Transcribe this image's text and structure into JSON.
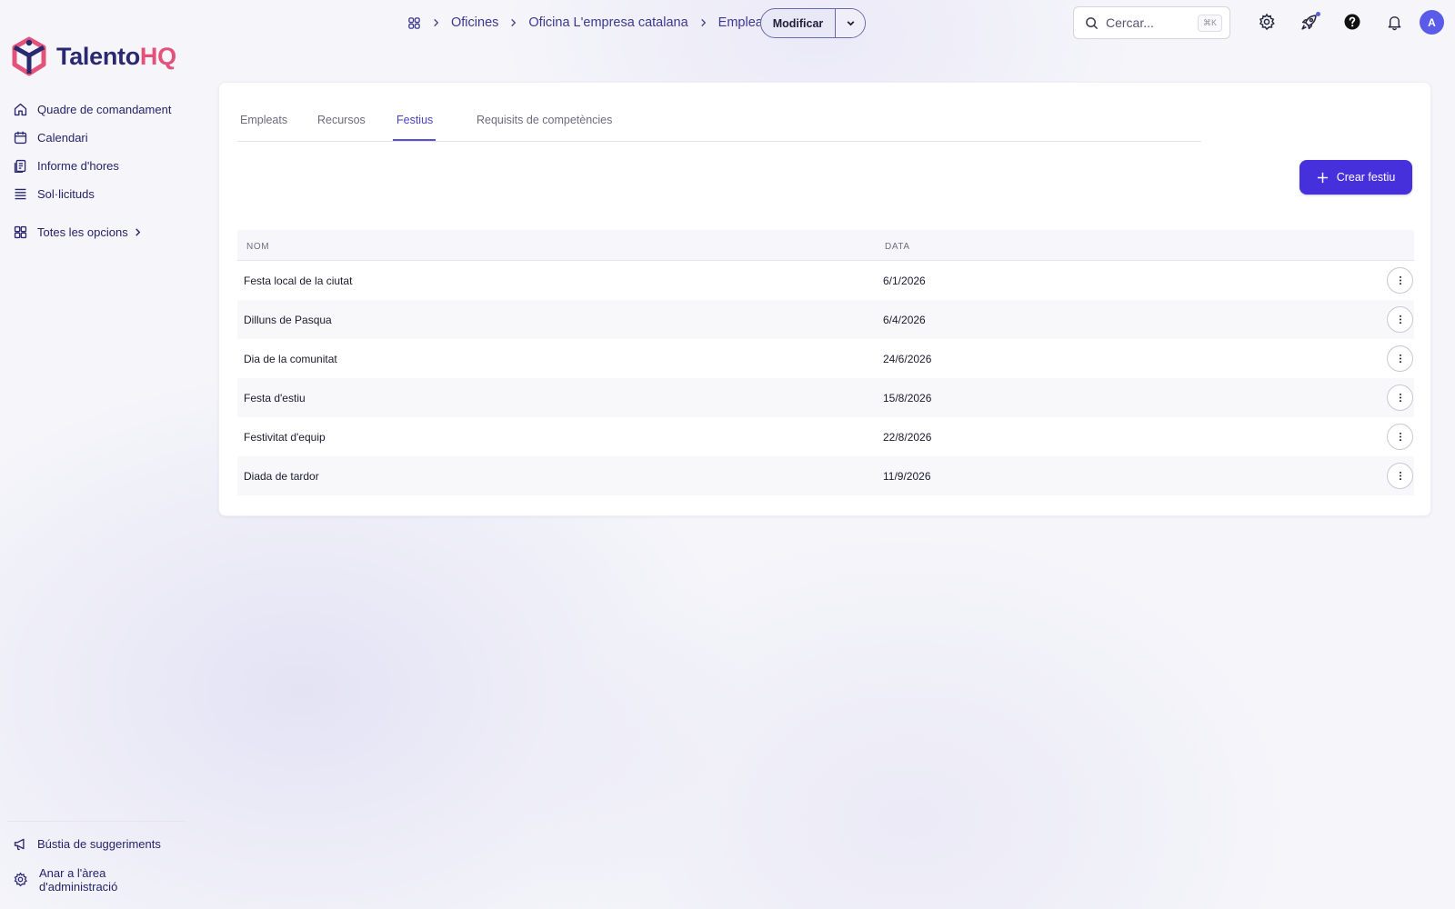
{
  "brand": {
    "name_part1": "Talento",
    "name_part2": "HQ",
    "logo_icon": "cube-logo",
    "primary": "#2b2872",
    "accent": "#e2527a"
  },
  "sidebar": {
    "items": [
      {
        "label": "Quadre de comandament",
        "icon": "home-icon"
      },
      {
        "label": "Calendari",
        "icon": "calendar-icon"
      },
      {
        "label": "Informe d'hores",
        "icon": "report-icon"
      },
      {
        "label": "Sol·licituds",
        "icon": "list-icon"
      }
    ],
    "all_options": {
      "label": "Totes les opcions",
      "icon": "grid-icon"
    },
    "bottom": [
      {
        "label": "Bústia de suggeriments",
        "icon": "megaphone-icon"
      },
      {
        "label_line1": "Anar a l'àrea",
        "label_line2": "d'administració",
        "icon": "gear-icon"
      }
    ]
  },
  "header": {
    "breadcrumb": [
      "Oficines",
      "Oficina L'empresa catalana",
      "Empleats"
    ],
    "edit_button": "Modificar",
    "search_placeholder": "Cercar...",
    "search_shortcut": "⌘K",
    "avatar_initial": "A",
    "icons": [
      "settings-icon",
      "rocket-icon",
      "help-icon",
      "bell-icon"
    ]
  },
  "tabs": [
    "Empleats",
    "Recursos",
    "Festius",
    "Requisits de competències"
  ],
  "active_tab": "Festius",
  "create_button": "Crear festiu",
  "table": {
    "columns": [
      "NOM",
      "DATA"
    ],
    "rows": [
      {
        "name": "Festa local de la ciutat",
        "date": "6/1/2026"
      },
      {
        "name": "Dilluns de Pasqua",
        "date": "6/4/2026"
      },
      {
        "name": "Dia de la comunitat",
        "date": "24/6/2026"
      },
      {
        "name": "Festa d'estiu",
        "date": "15/8/2026"
      },
      {
        "name": "Festivitat d'equip",
        "date": "22/8/2026"
      },
      {
        "name": "Diada de tardor",
        "date": "11/9/2026"
      }
    ]
  }
}
